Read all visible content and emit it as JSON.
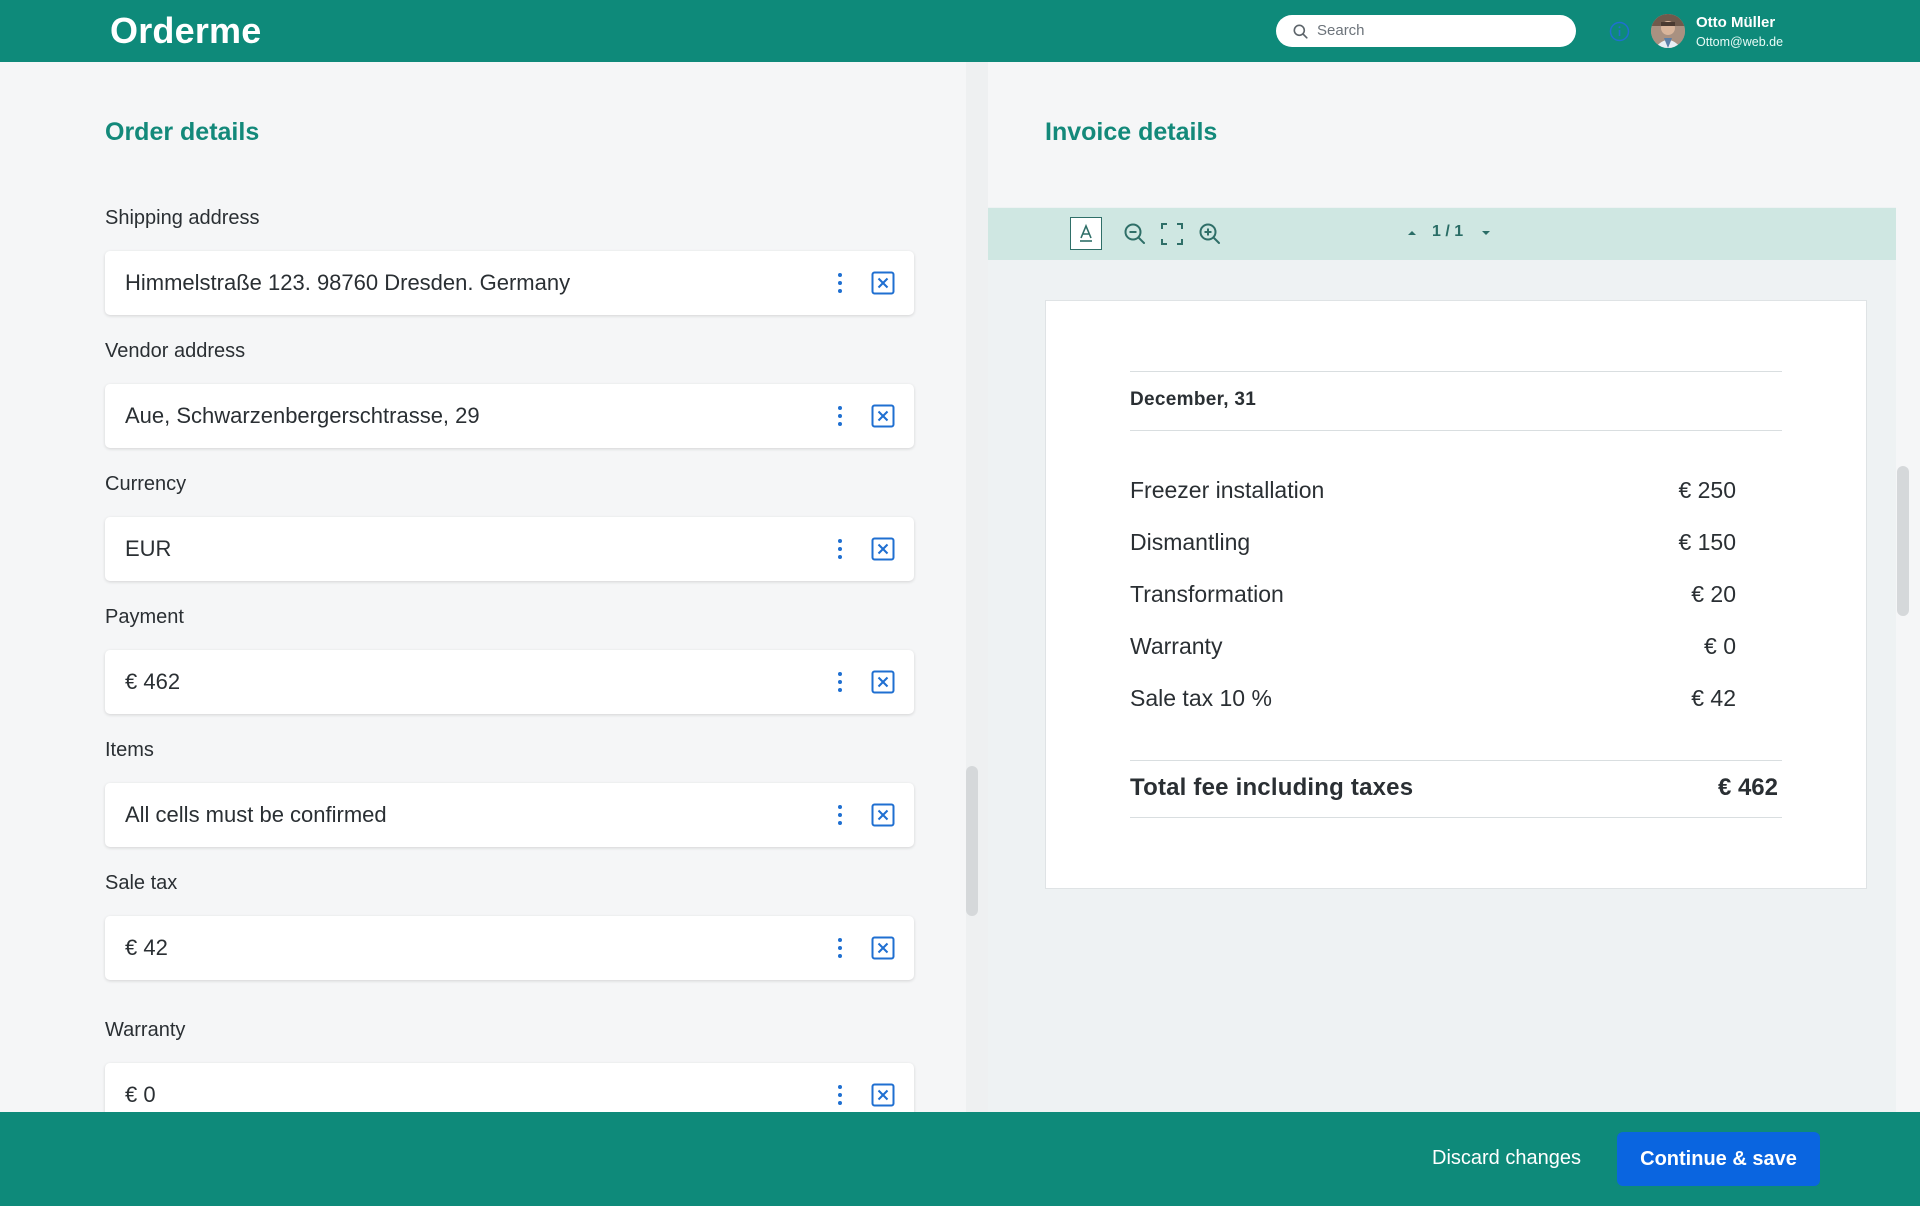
{
  "app": {
    "title": "Orderme"
  },
  "header": {
    "search_placeholder": "Search",
    "user_name": "Otto Müller",
    "user_email": "Ottom@web.de"
  },
  "order_details": {
    "title": "Order details",
    "fields": [
      {
        "label": "Shipping address",
        "value": "Himmelstraße 123. 98760 Dresden. Germany"
      },
      {
        "label": "Vendor address",
        "value": "Aue, Schwarzenbergerschtrasse, 29"
      },
      {
        "label": "Currency",
        "value": "EUR"
      },
      {
        "label": "Payment",
        "value": "€ 462"
      },
      {
        "label": "Items",
        "value": "All cells must be confirmed"
      },
      {
        "label": "Sale tax",
        "value": "€ 42"
      },
      {
        "label": "Warranty",
        "value": "€ 0"
      }
    ]
  },
  "invoice_details": {
    "title": "Invoice details",
    "viewer": {
      "page_indicator": "1 / 1"
    },
    "document": {
      "date": "December, 31",
      "items": [
        {
          "name": "Freezer installation",
          "amount": "€ 250"
        },
        {
          "name": "Dismantling",
          "amount": "€ 150"
        },
        {
          "name": "Transformation",
          "amount": "€ 20"
        },
        {
          "name": "Warranty",
          "amount": "€ 0"
        },
        {
          "name": "Sale tax 10 %",
          "amount": "€ 42"
        }
      ],
      "total_label": "Total fee including taxes",
      "total_amount": "€ 462"
    }
  },
  "footer": {
    "discard_label": "Discard changes",
    "save_label": "Continue & save"
  },
  "colors": {
    "brand": "#0e8a7a",
    "accent_text": "#13897a",
    "primary_button": "#0a65e0",
    "viewer_bar": "#cfe7e2",
    "icon_blue": "#1f6fd1"
  }
}
